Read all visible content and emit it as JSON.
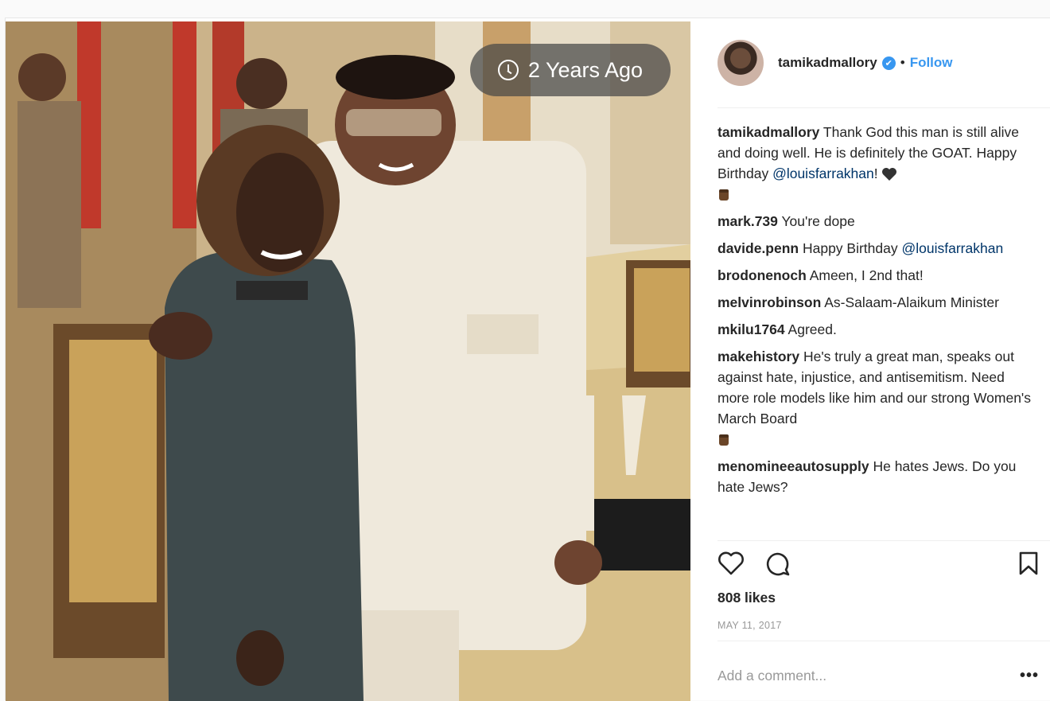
{
  "post": {
    "time_badge": "2 Years Ago",
    "author": "tamikadmallory",
    "follow_label": "Follow",
    "separator": "•",
    "likes": "808 likes",
    "date": "MAY 11, 2017",
    "add_comment_placeholder": "Add a comment...",
    "more_label": "•••"
  },
  "comments": [
    {
      "user": "tamikadmallory",
      "text": " Thank God this man is still alive and doing well. He is definitely the GOAT. Happy Birthday ",
      "mention": "@louisfarrakhan",
      "tail": "! "
    },
    {
      "user": "mark.739",
      "text": " You're dope"
    },
    {
      "user": "davide.penn",
      "text": " Happy Birthday ",
      "mention": "@louisfarrakhan"
    },
    {
      "user": "brodonenoch",
      "text": " Ameen, I 2nd that!"
    },
    {
      "user": "melvinrobinson",
      "text": " As-Salaam-Alaikum Minister"
    },
    {
      "user": "mkilu1764",
      "text": " Agreed."
    },
    {
      "user": "makehistory",
      "text": " He's truly a great man, speaks out against hate, injustice, and antisemitism. Need more role models like him and our strong Women's March Board "
    },
    {
      "user": "menomineeautosupply",
      "text": " He hates Jews. Do you hate Jews?"
    }
  ],
  "colors": {
    "accent": "#3897f0",
    "text": "#262626",
    "muted": "#999999"
  }
}
